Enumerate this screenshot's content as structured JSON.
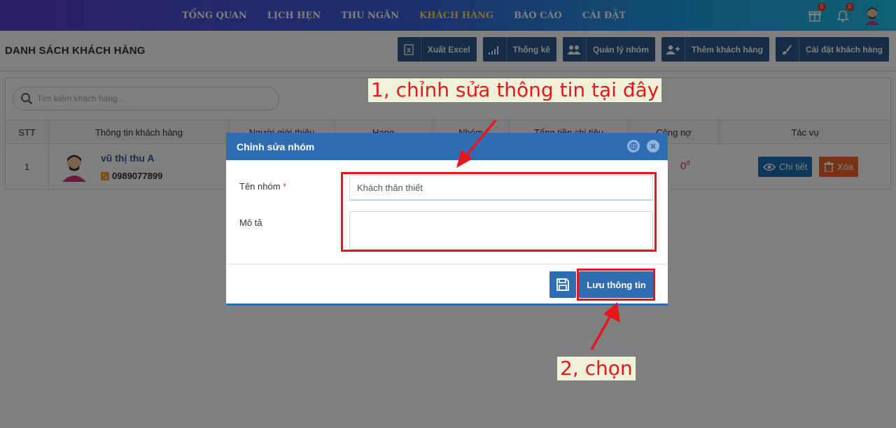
{
  "nav": {
    "menu": [
      "TỔNG QUAN",
      "LỊCH HẸN",
      "THU NGÂN",
      "KHÁCH HÀNG",
      "BÁO CÁO",
      "CÀI ĐẶT"
    ],
    "active_index": 3,
    "gift_badge": "0",
    "bell_badge": "0"
  },
  "header": {
    "title": "DANH SÁCH KHÁCH HÀNG",
    "actions": [
      "Xuất Excel",
      "Thống kê",
      "Quản lý nhóm",
      "Thêm khách hàng",
      "Cài đặt khách hàng"
    ]
  },
  "search": {
    "placeholder": "Tìm kiếm khách hàng..."
  },
  "table": {
    "columns": [
      "STT",
      "Thông tin khách hàng",
      "Người giới thiệu",
      "Hạng",
      "Nhóm",
      "Tổng tiền chi tiêu",
      "Công nợ",
      "Tác vụ"
    ],
    "rows": [
      {
        "stt": "1",
        "name": "vũ thị thu A",
        "phone": "0989077899",
        "debt": "0",
        "debt_unit": "đ"
      }
    ],
    "detail_label": "Chi tiết",
    "delete_label": "Xóa"
  },
  "modal": {
    "title": "Chỉnh sửa nhóm",
    "name_label": "Tên nhóm",
    "required_mark": "*",
    "name_value": "Khách thân thiết",
    "desc_label": "Mô tả",
    "desc_value": "",
    "save_label": "Lưu thông tin"
  },
  "annotations": {
    "step1": "1, chỉnh sửa thông tin tại đây",
    "step2": "2, chọn"
  },
  "colors": {
    "primary": "#2f6db3",
    "header_btn": "#2f5b8f",
    "danger": "#f0652b",
    "annotation": "#e8161c",
    "active_menu": "#ffe14d"
  }
}
